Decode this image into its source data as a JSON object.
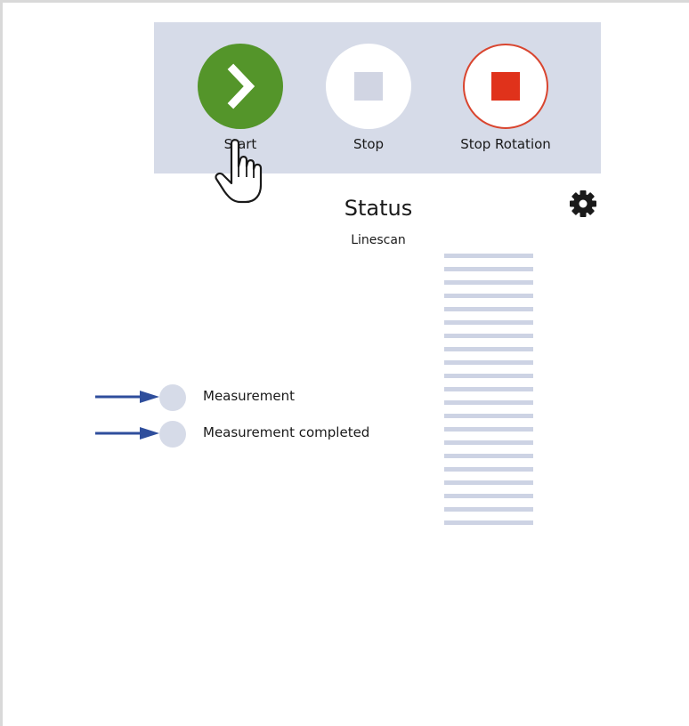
{
  "toolbar": {
    "start_label": "Start",
    "stop_label": "Stop",
    "stop_rotation_label": "Stop Rotation"
  },
  "status": {
    "title": "Status",
    "mode": "Linescan"
  },
  "indicators": [
    {
      "label": "Measurement"
    },
    {
      "label": "Measurement completed"
    }
  ],
  "colors": {
    "toolbar_bg": "#d6dbe8",
    "start_green": "#54952a",
    "stop_rotation_red": "#d9452f",
    "stop_icon_gray": "#d1d5e3",
    "led_off": "#d6dbe8",
    "arrow_blue": "#2f4e9c"
  },
  "icons": {
    "start": "chevron-right-icon",
    "stop": "square-stop-icon",
    "stop_rotation": "square-stop-icon",
    "settings": "gear-icon",
    "cursor": "hand-pointer-cursor"
  }
}
